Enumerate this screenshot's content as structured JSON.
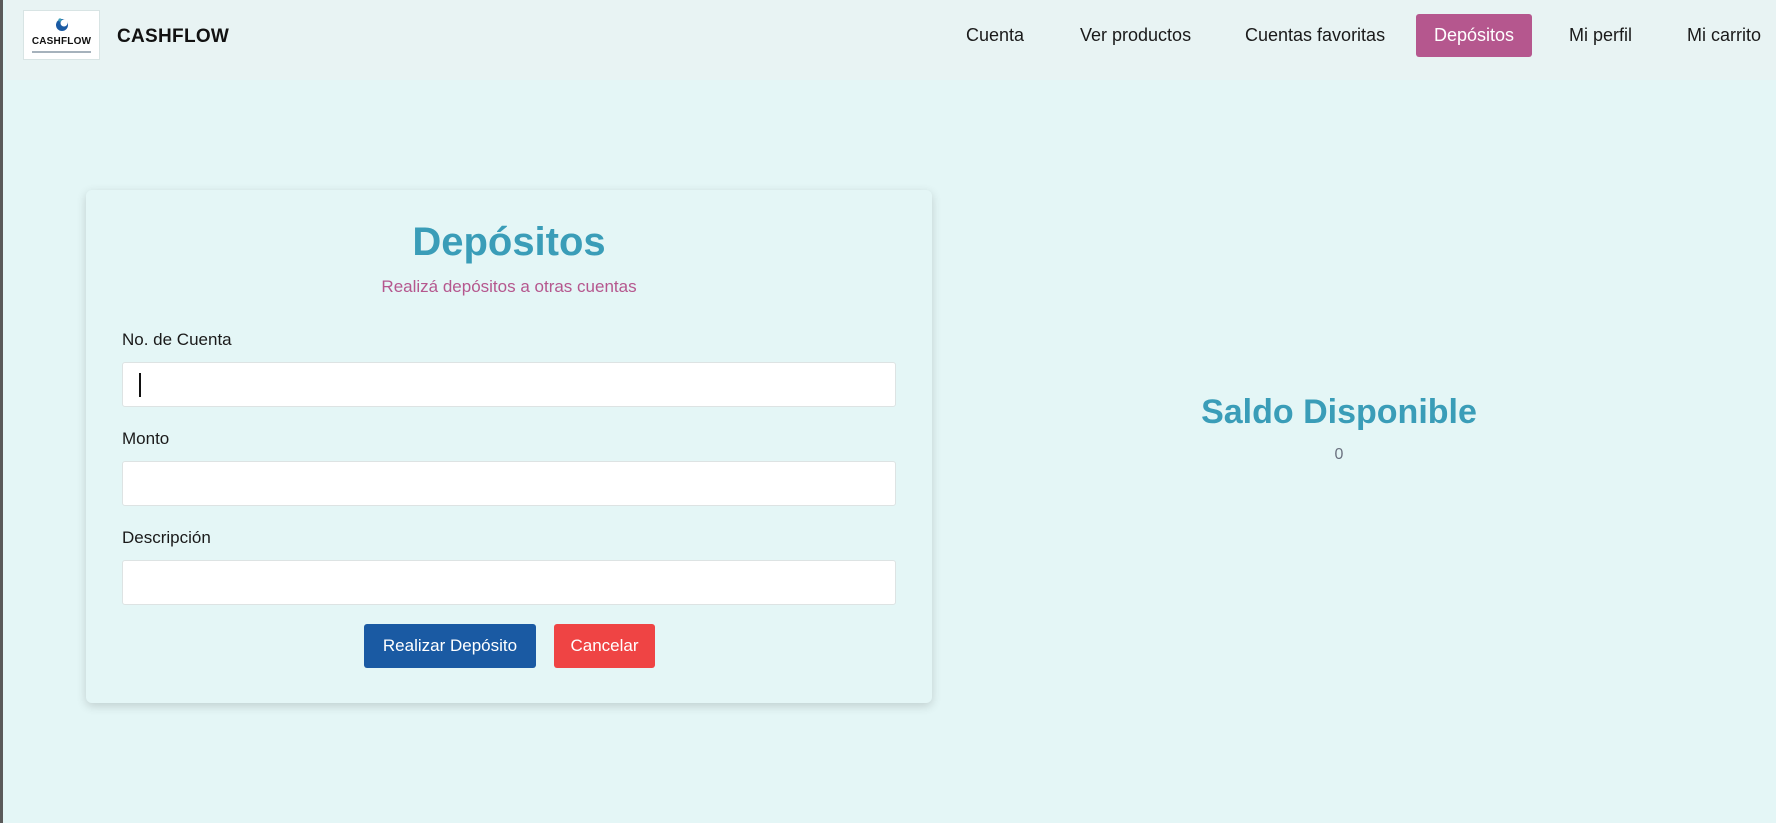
{
  "navbar": {
    "logo_text": "CASHFLOW",
    "brand_name": "CASHFLOW",
    "items": [
      {
        "label": "Cuenta",
        "active": false
      },
      {
        "label": "Ver productos",
        "active": false
      },
      {
        "label": "Cuentas favoritas",
        "active": false
      },
      {
        "label": "Depósitos",
        "active": true
      },
      {
        "label": "Mi perfil",
        "active": false
      },
      {
        "label": "Mi carrito",
        "active": false
      }
    ]
  },
  "form": {
    "title": "Depósitos",
    "subtitle": "Realizá depósitos a otras cuentas",
    "fields": [
      {
        "label": "No. de Cuenta",
        "value": "",
        "focused": true
      },
      {
        "label": "Monto",
        "value": ""
      },
      {
        "label": "Descripción",
        "value": ""
      }
    ],
    "submit_label": "Realizar Depósito",
    "cancel_label": "Cancelar"
  },
  "balance": {
    "title": "Saldo Disponible",
    "value": "0"
  },
  "colors": {
    "page_bg": "#e4f6f6",
    "navbar_bg": "#e8f3f3",
    "accent_teal": "#3a9db8",
    "accent_pink": "#b5578e",
    "primary_button": "#1a5aa3",
    "danger_button": "#ef4444"
  }
}
